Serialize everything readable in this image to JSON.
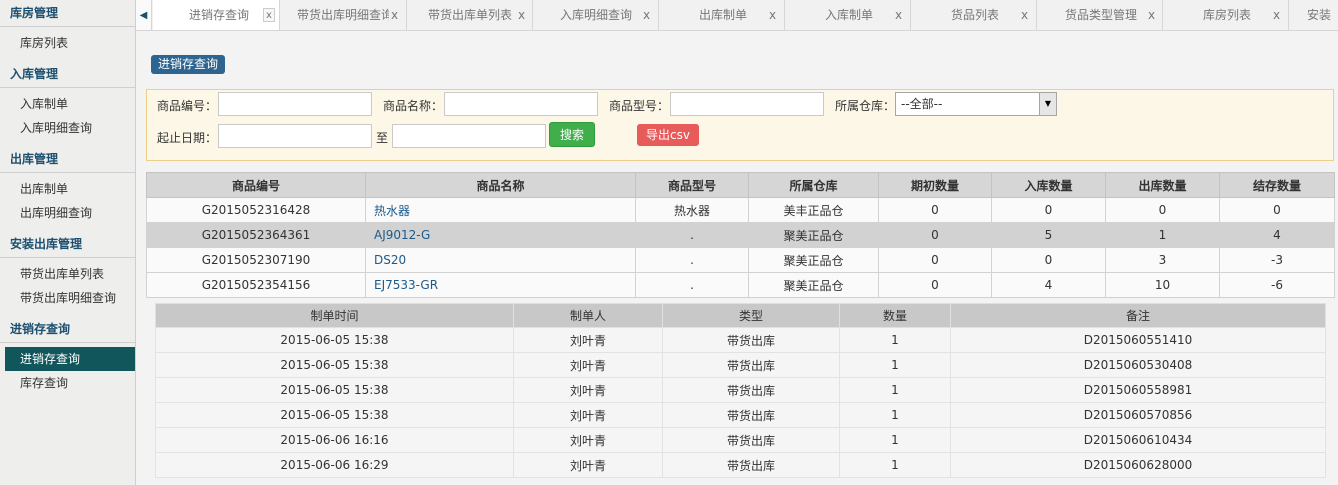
{
  "sidebar": {
    "groups": [
      {
        "title": "库房管理",
        "items": [
          "库房列表"
        ]
      },
      {
        "title": "入库管理",
        "items": [
          "入库制单",
          "入库明细查询"
        ]
      },
      {
        "title": "出库管理",
        "items": [
          "出库制单",
          "出库明细查询"
        ]
      },
      {
        "title": "安装出库管理",
        "items": [
          "带货出库单列表",
          "带货出库明细查询"
        ]
      },
      {
        "title": "进销存查询",
        "items": [
          "进销存查询",
          "库存查询"
        ]
      }
    ],
    "active_item": "进销存查询"
  },
  "tabs": {
    "left_arrow": "◀",
    "items": [
      {
        "label": "进销存查询",
        "close": "x"
      },
      {
        "label": "带货出库明细查询",
        "close": "x"
      },
      {
        "label": "带货出库单列表",
        "close": "x"
      },
      {
        "label": "入库明细查询",
        "close": "x"
      },
      {
        "label": "出库制单",
        "close": "x"
      },
      {
        "label": "入库制单",
        "close": "x"
      },
      {
        "label": "货品列表",
        "close": "x"
      },
      {
        "label": "货品类型管理",
        "close": "x"
      },
      {
        "label": "库房列表",
        "close": "x"
      },
      {
        "label": "安装",
        "close": ""
      }
    ]
  },
  "page": {
    "title": "进销存查询"
  },
  "filter": {
    "product_code_label": "商品编号：",
    "product_name_label": "商品名称：",
    "product_model_label": "商品型号：",
    "warehouse_label": "所属仓库：",
    "warehouse_value": "--全部--",
    "date_label": "起止日期：",
    "date_to_label": "至",
    "search_button": "搜索",
    "export_button": "导出csv"
  },
  "main_table": {
    "headers": [
      "商品编号",
      "商品名称",
      "商品型号",
      "所属仓库",
      "期初数量",
      "入库数量",
      "出库数量",
      "结存数量"
    ],
    "rows": [
      [
        "G2015052316428",
        "热水器",
        "热水器",
        "美丰正品仓",
        "0",
        "0",
        "0",
        "0"
      ],
      [
        "G2015052364361",
        "AJ9012-G",
        ".",
        "聚美正品仓",
        "0",
        "5",
        "1",
        "4"
      ],
      [
        "G2015052307190",
        "DS20",
        ".",
        "聚美正品仓",
        "0",
        "0",
        "3",
        "-3"
      ],
      [
        "G2015052354156",
        "EJ7533-GR",
        ".",
        "聚美正品仓",
        "0",
        "4",
        "10",
        "-6"
      ]
    ]
  },
  "detail_table": {
    "headers": [
      "制单时间",
      "制单人",
      "类型",
      "数量",
      "备注"
    ],
    "rows": [
      [
        "2015-06-05 15:38",
        "刘叶青",
        "带货出库",
        "1",
        "D2015060551410"
      ],
      [
        "2015-06-05 15:38",
        "刘叶青",
        "带货出库",
        "1",
        "D2015060530408"
      ],
      [
        "2015-06-05 15:38",
        "刘叶青",
        "带货出库",
        "1",
        "D2015060558981"
      ],
      [
        "2015-06-05 15:38",
        "刘叶青",
        "带货出库",
        "1",
        "D2015060570856"
      ],
      [
        "2015-06-06 16:16",
        "刘叶青",
        "带货出库",
        "1",
        "D2015060610434"
      ],
      [
        "2015-06-06 16:29",
        "刘叶青",
        "带货出库",
        "1",
        "D2015060628000"
      ]
    ]
  },
  "colors": {
    "accent": "#10565a",
    "badge": "#2d6590",
    "search_button": "#3fae4b",
    "export_button": "#e85b5b",
    "filter_bg": "#fdf7e7",
    "filter_border": "#efcf85",
    "link": "#1d5a8a"
  }
}
